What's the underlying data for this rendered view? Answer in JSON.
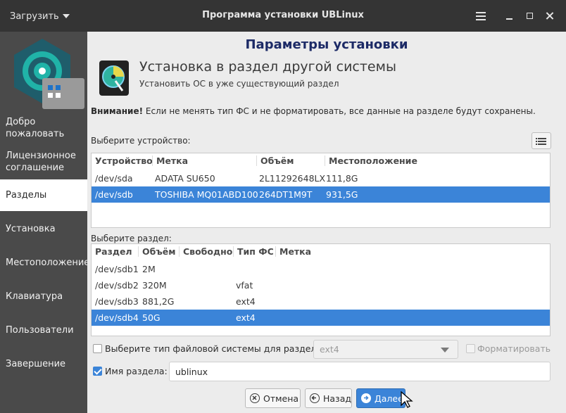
{
  "window": {
    "title": "Программа установки UBLinux",
    "load_menu": "Загрузить"
  },
  "sidebar": {
    "items": [
      {
        "label": "Добро пожаловать",
        "active": false
      },
      {
        "label": "Лицензионное соглашение",
        "active": false
      },
      {
        "label": "Разделы",
        "active": true
      },
      {
        "label": "Установка",
        "active": false
      },
      {
        "label": "Местоположение",
        "active": false
      },
      {
        "label": "Клавиатура",
        "active": false
      },
      {
        "label": "Пользователи",
        "active": false
      },
      {
        "label": "Завершение",
        "active": false
      }
    ]
  },
  "main": {
    "page_title": "Параметры установки",
    "section_title": "Установка в раздел другой системы",
    "section_subtitle": "Установить ОС в уже существующий раздел",
    "warning_strong": "Внимание!",
    "warning_text": " Если не менять тип ФС и не форматировать, все данные на разделе будут сохранены.",
    "device_label": "Выберите устройство:",
    "partition_label": "Выберите раздел:"
  },
  "devices": {
    "columns": [
      "Устройство",
      "Метка",
      "Объём",
      "Местоположение"
    ],
    "rows": [
      {
        "device": "/dev/sda",
        "label": "ADATA SU650",
        "volume": "2L11292648LX",
        "location": "111,8G",
        "selected": false
      },
      {
        "device": "/dev/sdb",
        "label": "TOSHIBA MQ01ABD100",
        "volume": "264DT1M9T",
        "location": "931,5G",
        "selected": true
      }
    ]
  },
  "partitions": {
    "columns": [
      "Раздел",
      "Объём",
      "Свободно",
      "Тип ФС",
      "Метка"
    ],
    "rows": [
      {
        "part": "/dev/sdb1",
        "volume": "2M",
        "free": "",
        "fs": "",
        "label": "",
        "selected": false
      },
      {
        "part": "/dev/sdb2",
        "volume": "320M",
        "free": "",
        "fs": "vfat",
        "label": "",
        "selected": false
      },
      {
        "part": "/dev/sdb3",
        "volume": "881,2G",
        "free": "",
        "fs": "ext4",
        "label": "",
        "selected": false
      },
      {
        "part": "/dev/sdb4",
        "volume": "50G",
        "free": "",
        "fs": "ext4",
        "label": "",
        "selected": true
      }
    ]
  },
  "options": {
    "fs_checkbox_label": "Выберите тип файловой системы для раздела",
    "fs_checked": false,
    "fs_value": "ext4",
    "format_label": "Форматировать",
    "format_checked": false,
    "name_checkbox_label": "Имя раздела:",
    "name_checked": true,
    "name_value": "ublinux"
  },
  "buttons": {
    "cancel": "Отмена",
    "back": "Назад",
    "next": "Далее"
  },
  "colors": {
    "accent": "#3b84d8",
    "title": "#1c2a66",
    "sidebar_bg": "#4a4a4a",
    "titlebar_bg": "#343434"
  }
}
